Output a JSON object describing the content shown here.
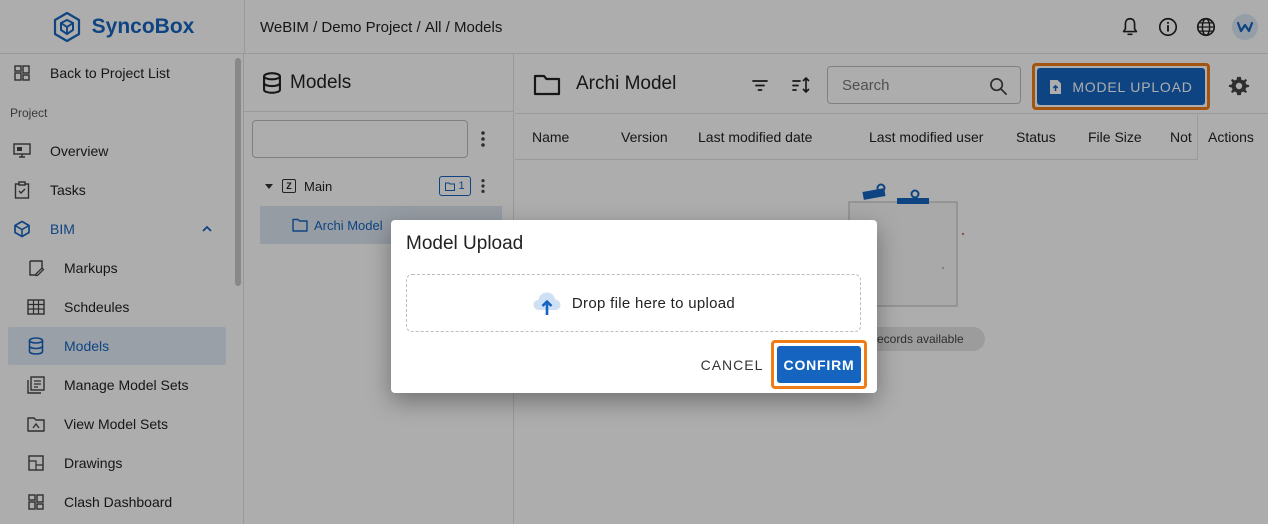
{
  "app": {
    "name": "SyncoBox"
  },
  "breadcrumb": [
    "WeBIM",
    "Demo Project",
    "All",
    "Models"
  ],
  "topbar_icons": [
    "bell-icon",
    "info-icon",
    "globe-icon",
    "user-avatar"
  ],
  "sidebar": {
    "back_label": "Back to Project List",
    "section_label": "Project",
    "items": [
      {
        "label": "Overview",
        "icon": "overview-icon"
      },
      {
        "label": "Tasks",
        "icon": "clipboard-icon"
      },
      {
        "label": "BIM",
        "icon": "cube-icon"
      },
      {
        "label": "Markups",
        "icon": "markup-icon"
      },
      {
        "label": "Schdeules",
        "icon": "table-icon"
      },
      {
        "label": "Models",
        "icon": "database-icon"
      },
      {
        "label": "Manage Model Sets",
        "icon": "modelset-icon"
      },
      {
        "label": "View Model Sets",
        "icon": "folder-view-icon"
      },
      {
        "label": "Drawings",
        "icon": "drawing-icon"
      },
      {
        "label": "Clash Dashboard",
        "icon": "dashboard-icon"
      }
    ]
  },
  "tree": {
    "title": "Models",
    "search_value": "",
    "nodes": [
      {
        "label": "Main",
        "badge_count": "1"
      },
      {
        "label": "Archi Model"
      }
    ]
  },
  "main": {
    "folder_title": "Archi Model",
    "search_placeholder": "Search",
    "upload_label": "MODEL UPLOAD",
    "columns": [
      "Name",
      "Version",
      "Last modified date",
      "Last modified user",
      "Status",
      "File Size",
      "Not",
      "Actions"
    ],
    "empty_text": "No records available"
  },
  "dialog": {
    "title": "Model Upload",
    "drop_text": "Drop file here to upload",
    "cancel_label": "CANCEL",
    "confirm_label": "CONFIRM"
  },
  "colors": {
    "primary": "#1565c0",
    "highlight": "#f07c16"
  }
}
